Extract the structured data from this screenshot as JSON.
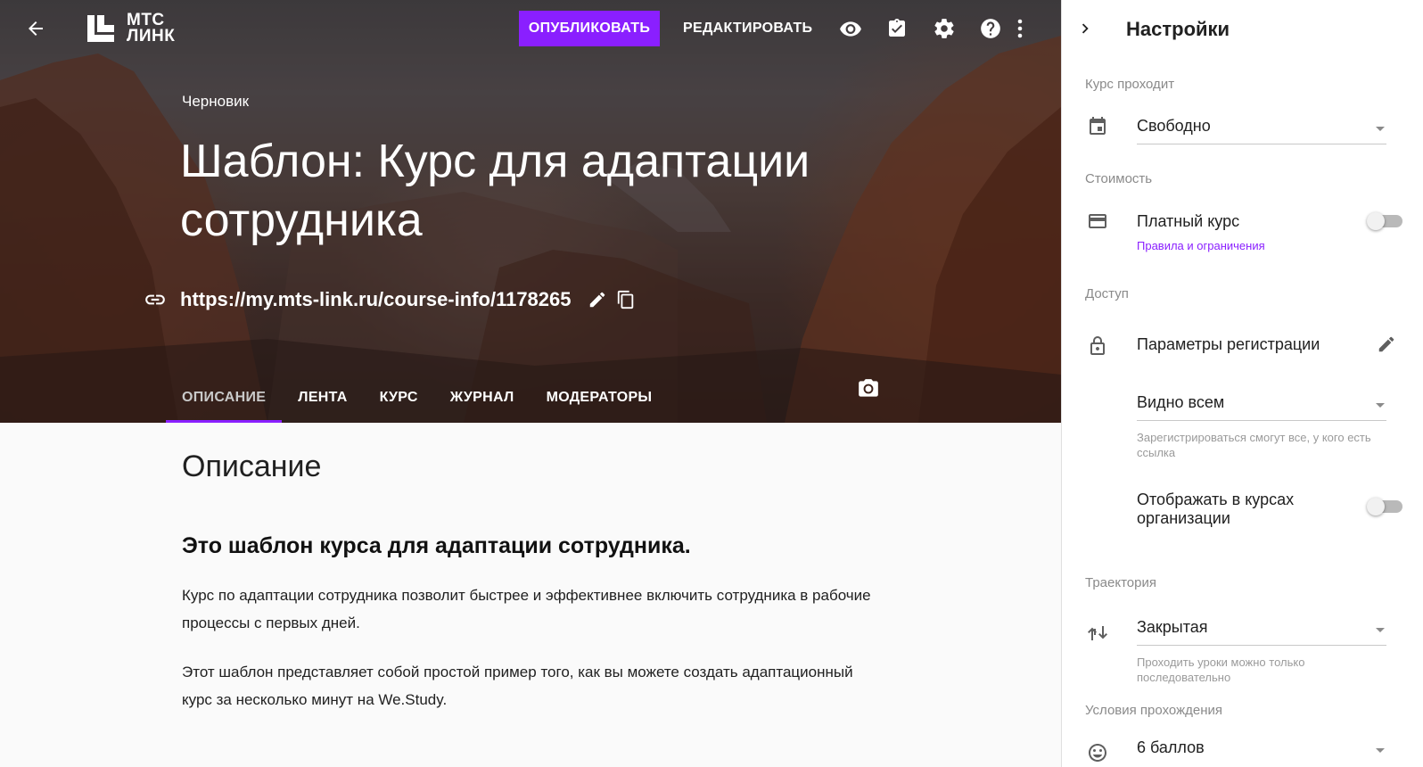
{
  "header": {
    "logo_line1": "МТС",
    "logo_line2": "ЛИНК",
    "publish_label": "ОПУБЛИКОВАТЬ",
    "edit_label": "РЕДАКТИРОВАТЬ"
  },
  "course": {
    "status": "Черновик",
    "title": "Шаблон: Курс для адаптации сотрудника",
    "url": "https://my.mts-link.ru/course-info/1178265"
  },
  "tabs": [
    {
      "label": "ОПИСАНИЕ",
      "active": true
    },
    {
      "label": "ЛЕНТА",
      "active": false
    },
    {
      "label": "КУРС",
      "active": false
    },
    {
      "label": "ЖУРНАЛ",
      "active": false
    },
    {
      "label": "МОДЕРАТОРЫ",
      "active": false
    }
  ],
  "description": {
    "section_title": "Описание",
    "heading": "Это шаблон курса для адаптации сотрудника.",
    "paragraph1": "Курс по адаптации сотрудника позволит быстрее и эффективнее включить сотрудника в рабочие процессы с первых дней.",
    "paragraph2": "Этот шаблон представляет собой простой пример того, как вы можете создать адаптационный курс за несколько минут на We.Study."
  },
  "settings": {
    "title": "Настройки",
    "mode_label": "Курс проходит",
    "mode_value": "Свободно",
    "cost_label": "Стоимость",
    "paid_course": "Платный курс",
    "paid_enabled": false,
    "rules_link": "Правила и ограничения",
    "access_label": "Доступ",
    "registration_params": "Параметры регистрации",
    "visibility_value": "Видно всем",
    "visibility_help": "Зарегистрироваться смогут все, у кого есть ссылка",
    "show_in_org": "Отображать в курсах организации",
    "show_in_org_enabled": false,
    "trajectory_label": "Траектория",
    "trajectory_value": "Закрытая",
    "trajectory_help": "Проходить уроки можно только последовательно",
    "completion_label": "Условия прохождения",
    "completion_value": "6 баллов"
  },
  "colors": {
    "accent": "#8a1fff",
    "panel_bg": "#ffffff",
    "content_bg": "#fafafa"
  }
}
